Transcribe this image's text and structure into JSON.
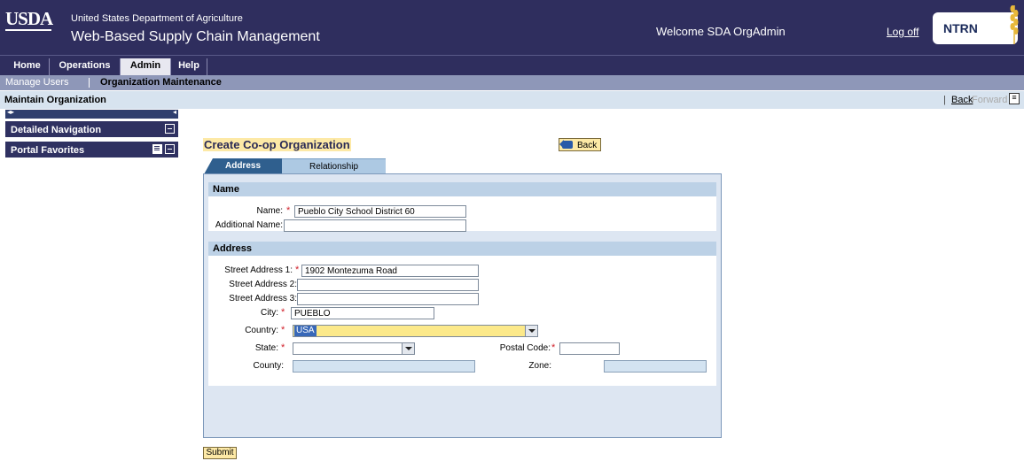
{
  "header": {
    "logo": "USDA",
    "department": "United States Department of Agriculture",
    "app_name": "Web-Based Supply Chain Management",
    "welcome": "Welcome SDA OrgAdmin",
    "logoff": "Log off",
    "badge": "NTRN"
  },
  "topnav": {
    "tabs": [
      {
        "label": "Home"
      },
      {
        "label": "Operations"
      },
      {
        "label": "Admin"
      },
      {
        "label": "Help"
      }
    ],
    "active": "Admin"
  },
  "subnav": {
    "items": [
      {
        "label": "Manage Users"
      },
      {
        "label": "Organization Maintenance"
      }
    ],
    "active": "Organization Maintenance"
  },
  "pagebar": {
    "title": "Maintain Organization",
    "separator": "|",
    "back": "Back",
    "forward": "Forward"
  },
  "sidebar": {
    "panels": [
      {
        "label": "Detailed Navigation"
      },
      {
        "label": "Portal Favorites"
      }
    ]
  },
  "form": {
    "title": "Create Co-op Organization",
    "back_button": "Back",
    "tabs": [
      {
        "label": "Address"
      },
      {
        "label": "Relationship"
      }
    ],
    "name_section": {
      "heading": "Name",
      "name_label": "Name:",
      "name_value": "Pueblo City School District 60",
      "additional_name_label": "Additional Name:",
      "additional_name_value": ""
    },
    "address_section": {
      "heading": "Address",
      "street1_label": "Street Address 1:",
      "street1_value": "1902 Montezuma Road",
      "street2_label": "Street Address 2:",
      "street2_value": "",
      "street3_label": "Street Address 3:",
      "street3_value": "",
      "city_label": "City:",
      "city_value": "PUEBLO",
      "country_label": "Country:",
      "country_value": "USA",
      "state_label": "State:",
      "state_value": "",
      "postal_label": "Postal Code:",
      "postal_value": "",
      "county_label": "County:",
      "county_value": "",
      "zone_label": "Zone:",
      "zone_value": ""
    },
    "required_marker": "*",
    "submit": "Submit"
  },
  "colors": {
    "header_bg": "#2f2e5e",
    "subnav_bg": "#8e97b8",
    "pagebar_bg": "#d7e3ef",
    "button_bg": "#fde9a6",
    "required": "#d0202a"
  }
}
